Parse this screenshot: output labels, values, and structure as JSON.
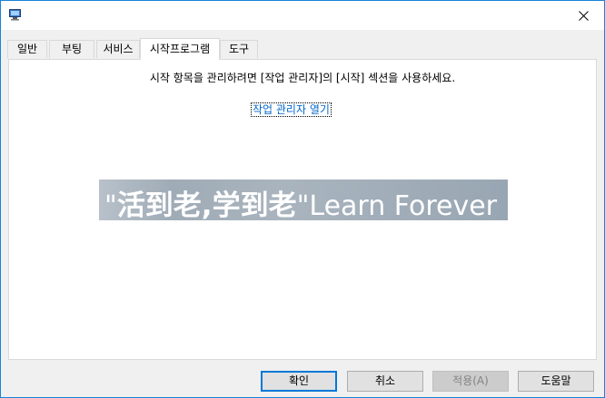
{
  "window": {
    "title": ""
  },
  "tabs": [
    {
      "label": "일반"
    },
    {
      "label": "부팅"
    },
    {
      "label": "서비스"
    },
    {
      "label": "시작프로그램"
    },
    {
      "label": "도구"
    }
  ],
  "startup": {
    "description": "시작 항목을 관리하려면 [작업 관리자]의 [시작] 섹션을 사용하세요.",
    "open_task_manager_link": "작업 관리자 열기"
  },
  "banner": {
    "quote_open": "\"",
    "chinese_text": "活到老,学到老",
    "quote_close": "\"",
    "english_text": "Learn Forever"
  },
  "buttons": {
    "ok": "확인",
    "cancel": "취소",
    "apply": "적용(A)",
    "help": "도움말"
  },
  "colors": {
    "accent": "#0078d7",
    "link": "#0066cc",
    "border": "#1883d7"
  }
}
